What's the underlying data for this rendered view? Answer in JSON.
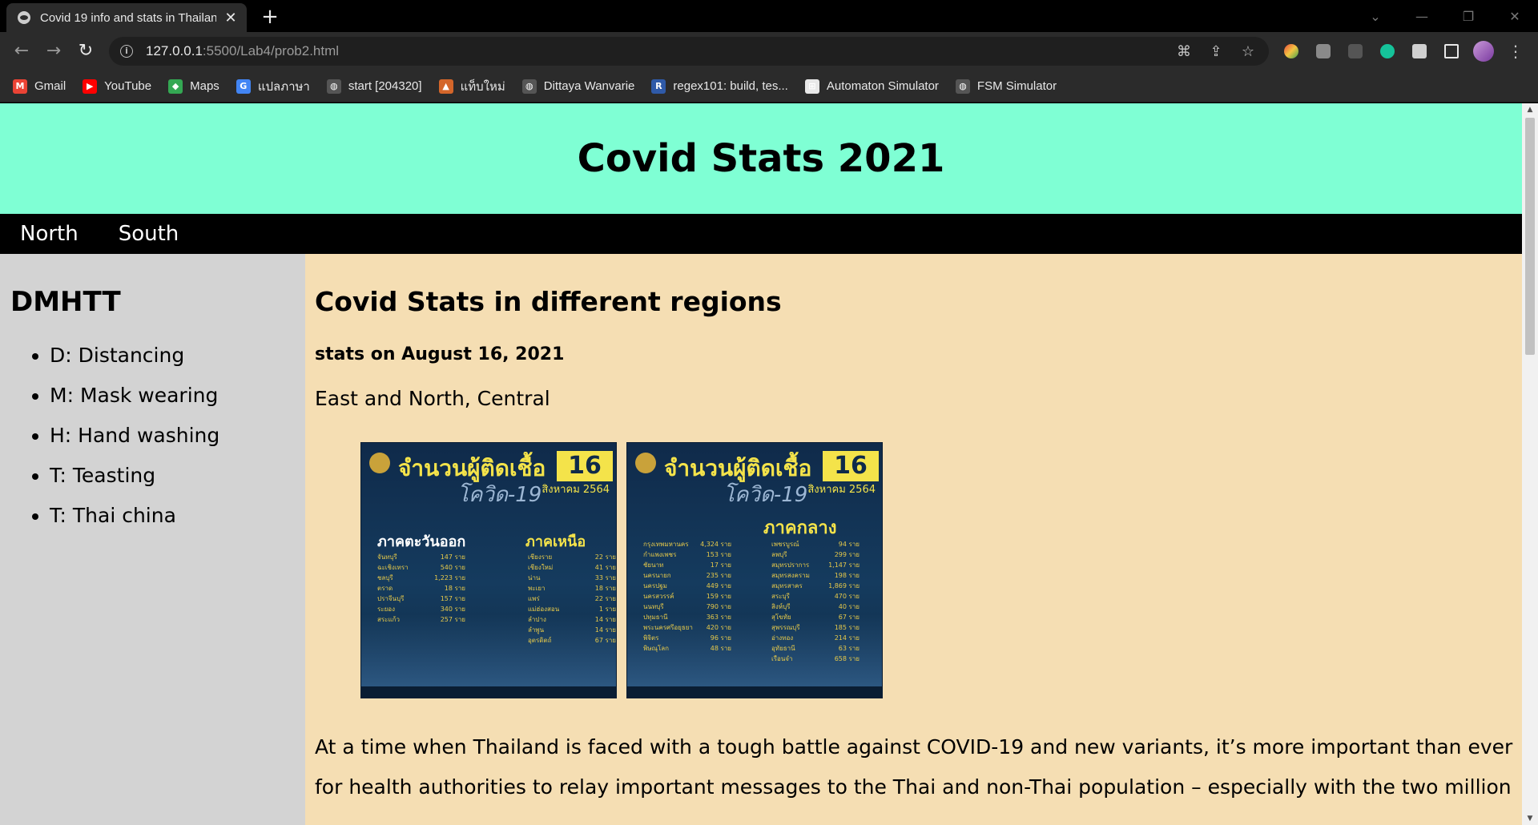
{
  "browser": {
    "tab_title": "Covid 19 info and stats in Thailand",
    "tab_close": "✕",
    "new_tab": "+",
    "url_host": "127.0.0.1",
    "url_path": ":5500/Lab4/prob2.html",
    "back_glyph": "←",
    "forward_glyph": "→",
    "reload_glyph": "↻",
    "window_controls": [
      "⌄",
      "—",
      "❐",
      "✕"
    ]
  },
  "bookmarks": [
    {
      "label": "Gmail",
      "icon": "gmail-icon",
      "color": "#ea4335",
      "glyph": "M"
    },
    {
      "label": "YouTube",
      "icon": "youtube-icon",
      "color": "#ff0000",
      "glyph": "▶"
    },
    {
      "label": "Maps",
      "icon": "maps-icon",
      "color": "#34a853",
      "glyph": "◆"
    },
    {
      "label": "แปลภาษา",
      "icon": "translate-icon",
      "color": "#4285f4",
      "glyph": "G"
    },
    {
      "label": "start [204320]",
      "icon": "globe-icon",
      "color": "#555555",
      "glyph": "◍"
    },
    {
      "label": "แท็บใหม่",
      "icon": "fire-icon",
      "color": "#d4662a",
      "glyph": "▲"
    },
    {
      "label": "Dittaya Wanvarie",
      "icon": "globe-icon",
      "color": "#555555",
      "glyph": "◍"
    },
    {
      "label": "regex101: build, tes...",
      "icon": "regex-icon",
      "color": "#2f5aa8",
      "glyph": "R"
    },
    {
      "label": "Automaton Simulator",
      "icon": "automaton-icon",
      "color": "#e8e8e8",
      "glyph": "⊞"
    },
    {
      "label": "FSM Simulator",
      "icon": "globe-icon",
      "color": "#555555",
      "glyph": "◍"
    }
  ],
  "page": {
    "header_title": "Covid Stats 2021",
    "nav": [
      "North",
      "South"
    ],
    "sidebar": {
      "title": "DMHTT",
      "items": [
        "D: Distancing",
        "M: Mask wearing",
        "H: Hand washing",
        "T: Teasting",
        "T: Thai china"
      ]
    },
    "main": {
      "title": "Covid Stats in different regions",
      "date": "stats on August 16, 2021",
      "regions": "East and North, Central",
      "images": [
        {
          "title": "จำนวนผู้ติดเชื้อ",
          "badge": "16",
          "subtitle": "โควิด-19",
          "month": "สิงหาคม 2564",
          "regions": [
            "ภาคตะวันออก",
            "ภาคเหนือ"
          ],
          "rows_left": [
            [
              "จันทบุรี",
              "147 ราย"
            ],
            [
              "ฉะเชิงเทรา",
              "540 ราย"
            ],
            [
              "ชลบุรี",
              "1,223 ราย"
            ],
            [
              "ตราด",
              "18 ราย"
            ],
            [
              "ปราจีนบุรี",
              "157 ราย"
            ],
            [
              "ระยอง",
              "340 ราย"
            ],
            [
              "สระแก้ว",
              "257 ราย"
            ]
          ],
          "rows_right": [
            [
              "เชียงราย",
              "22 ราย"
            ],
            [
              "เชียงใหม่",
              "41 ราย"
            ],
            [
              "น่าน",
              "33 ราย"
            ],
            [
              "พะเยา",
              "18 ราย"
            ],
            [
              "แพร่",
              "22 ราย"
            ],
            [
              "แม่ฮ่องสอน",
              "1 ราย"
            ],
            [
              "ลำปาง",
              "14 ราย"
            ],
            [
              "ลำพูน",
              "14 ราย"
            ],
            [
              "อุตรดิตถ์",
              "67 ราย"
            ]
          ]
        },
        {
          "title": "จำนวนผู้ติดเชื้อ",
          "badge": "16",
          "subtitle": "โควิด-19",
          "month": "สิงหาคม 2564",
          "regions": [
            "ภาคกลาง"
          ],
          "rows_left": [
            [
              "กรุงเทพมหานคร",
              "4,324 ราย"
            ],
            [
              "กำแพงเพชร",
              "153 ราย"
            ],
            [
              "ชัยนาท",
              "17 ราย"
            ],
            [
              "นครนายก",
              "235 ราย"
            ],
            [
              "นครปฐม",
              "449 ราย"
            ],
            [
              "นครสวรรค์",
              "159 ราย"
            ],
            [
              "นนทบุรี",
              "790 ราย"
            ],
            [
              "ปทุมธานี",
              "363 ราย"
            ],
            [
              "พระนครศรีอยุธยา",
              "420 ราย"
            ],
            [
              "พิจิตร",
              "96 ราย"
            ],
            [
              "พิษณุโลก",
              "48 ราย"
            ]
          ],
          "rows_right": [
            [
              "เพชรบูรณ์",
              "94 ราย"
            ],
            [
              "ลพบุรี",
              "299 ราย"
            ],
            [
              "สมุทรปราการ",
              "1,147 ราย"
            ],
            [
              "สมุทรสงคราม",
              "198 ราย"
            ],
            [
              "สมุทรสาคร",
              "1,869 ราย"
            ],
            [
              "สระบุรี",
              "470 ราย"
            ],
            [
              "สิงห์บุรี",
              "40 ราย"
            ],
            [
              "สุโขทัย",
              "67 ราย"
            ],
            [
              "สุพรรณบุรี",
              "185 ราย"
            ],
            [
              "อ่างทอง",
              "214 ราย"
            ],
            [
              "อุทัยธานี",
              "63 ราย"
            ],
            [
              "เรือนจำ",
              "658 ราย"
            ]
          ]
        }
      ],
      "paragraph": "At a time when Thailand is faced with a tough battle against COVID-19 and new variants, it’s more important than ever for health authorities to relay important messages to the Thai and non-Thai population – especially with the two million"
    }
  }
}
